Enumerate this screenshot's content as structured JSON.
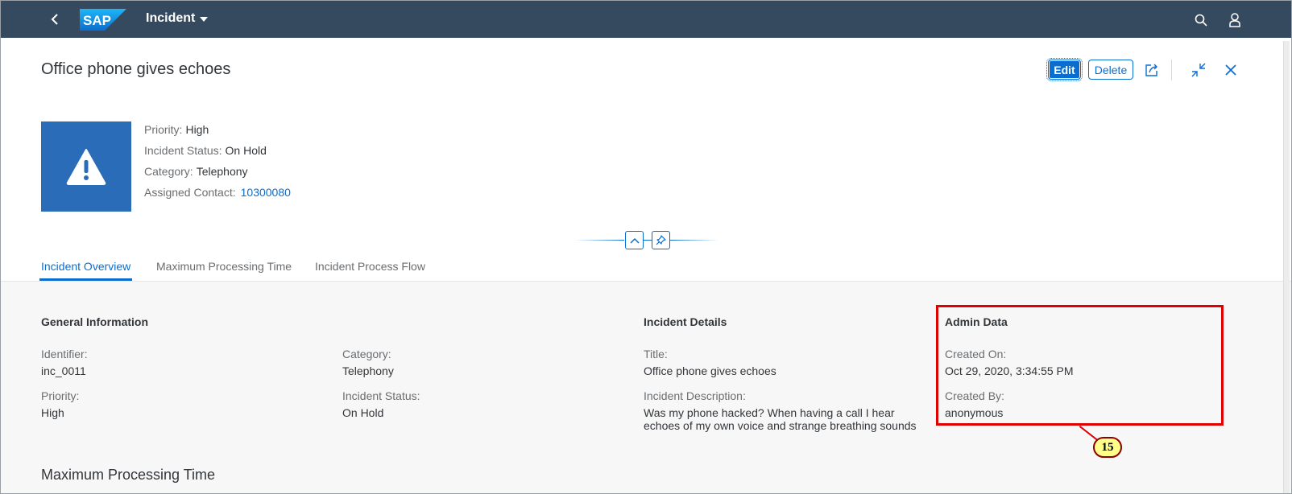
{
  "shell": {
    "logo_text": "SAP",
    "app_title": "Incident",
    "icons": [
      "back-icon",
      "search-icon",
      "user-icon"
    ]
  },
  "header": {
    "title": "Office phone gives echoes",
    "edit_label": "Edit",
    "delete_label": "Delete",
    "icons": [
      "share-icon",
      "exit-fullscreen-icon",
      "close-icon"
    ],
    "avatar_icon": "warning-icon",
    "attributes": {
      "priority_label": "Priority:",
      "priority_value": "High",
      "status_label": "Incident Status:",
      "status_value": "On Hold",
      "category_label": "Category:",
      "category_value": "Telephony",
      "contact_label": "Assigned Contact:",
      "contact_value": "10300080"
    }
  },
  "tabs": [
    {
      "label": "Incident Overview",
      "active": true
    },
    {
      "label": "Maximum Processing Time",
      "active": false
    },
    {
      "label": "Incident Process Flow",
      "active": false
    }
  ],
  "sections": {
    "general": {
      "title": "General Information",
      "identifier_label": "Identifier:",
      "identifier_value": "inc_0011",
      "category_label": "Category:",
      "category_value": "Telephony",
      "priority_label": "Priority:",
      "priority_value": "High",
      "status_label": "Incident Status:",
      "status_value": "On Hold"
    },
    "details": {
      "title": "Incident Details",
      "title_label": "Title:",
      "title_value": "Office phone gives echoes",
      "description_label": "Incident Description:",
      "description_line1": "Was my phone hacked? When having a call I hear",
      "description_line2": "echoes of my own voice and strange breathing sounds"
    },
    "admin": {
      "title": "Admin Data",
      "created_on_label": "Created On:",
      "created_on_value": "Oct 29, 2020, 3:34:55 PM",
      "created_by_label": "Created By:",
      "created_by_value": "anonymous"
    },
    "next_heading": "Maximum Processing Time"
  },
  "annotation": {
    "badge": "15",
    "color": "#e00000"
  },
  "colors": {
    "shell": "#354a5f",
    "accent": "#0a6ed1",
    "avatar": "#2b6cb8"
  }
}
